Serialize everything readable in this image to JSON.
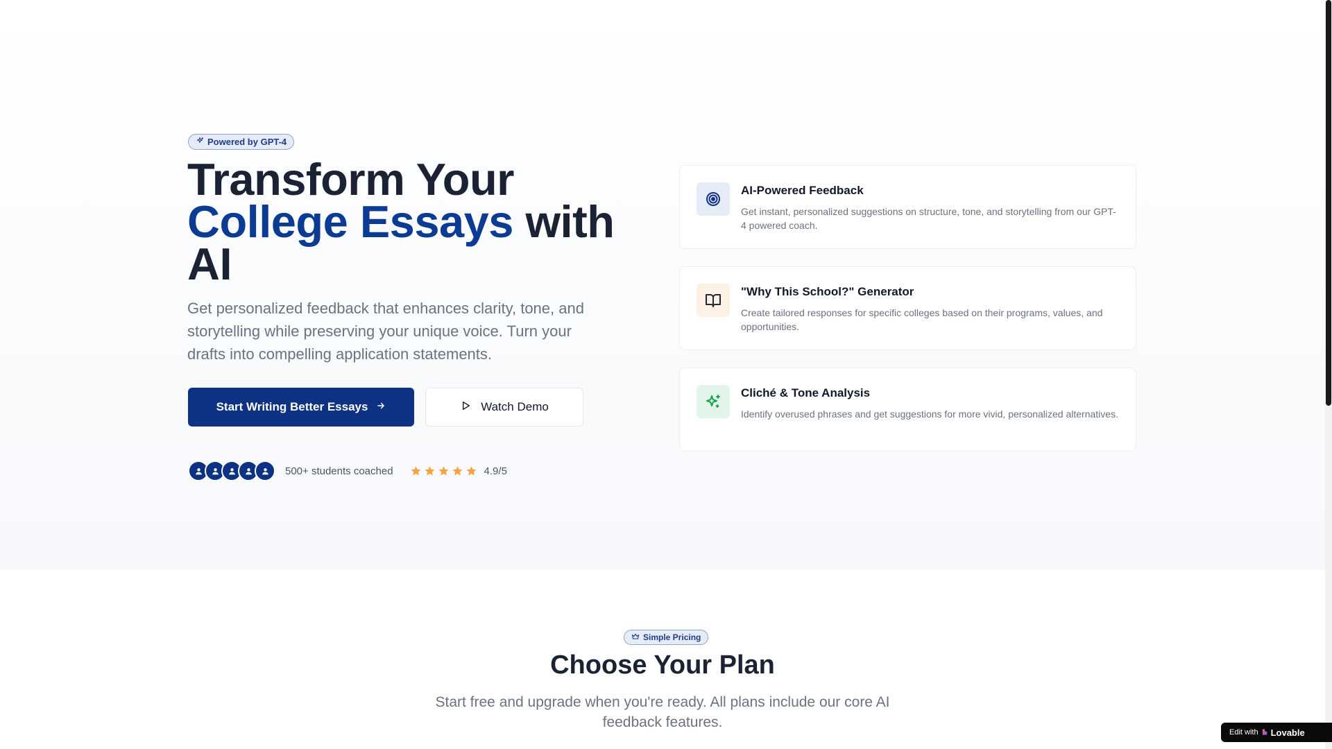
{
  "hero": {
    "badge": "Powered by GPT-4",
    "headline_line1": "Transform Your",
    "headline_accent": "College Essays",
    "headline_mid": " with",
    "headline_line3": "AI",
    "subtext": "Get personalized feedback that enhances clarity, tone, and storytelling while preserving your unique voice. Turn your drafts into compelling application statements.",
    "primary_button": "Start Writing Better Essays",
    "secondary_button": "Watch Demo",
    "students_text": "500+ students coached",
    "rating": "4.9/5",
    "stars": 5,
    "avatar_count": 5
  },
  "features": [
    {
      "icon": "target-icon",
      "title": "AI-Powered Feedback",
      "description": "Get instant, personalized suggestions on structure, tone, and storytelling from our GPT-4 powered coach."
    },
    {
      "icon": "book-open-icon",
      "title": "\"Why This School?\" Generator",
      "description": "Create tailored responses for specific colleges based on their programs, values, and opportunities."
    },
    {
      "icon": "sparkles-icon",
      "title": "Cliché & Tone Analysis",
      "description": "Identify overused phrases and get suggestions for more vivid, personalized alternatives."
    }
  ],
  "pricing": {
    "badge": "Simple Pricing",
    "title": "Choose Your Plan",
    "subtitle": "Start free and upgrade when you're ready. All plans include our core AI feedback features."
  },
  "lovable_badge": {
    "prefix": "Edit with",
    "brand": "Lovable",
    "close": "×"
  },
  "colors": {
    "primary": "#0d3284",
    "accent_text": "#0b3b93",
    "star": "#f4a340",
    "feature1_bg": "#e6ecf7",
    "feature2_bg": "#fdf1e6",
    "feature3_bg": "#e3f5ea"
  }
}
